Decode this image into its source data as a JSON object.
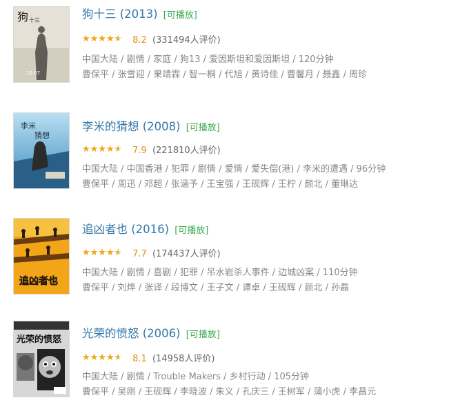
{
  "colors": {
    "title": "#3377aa",
    "play": "#3ba94d",
    "star": "#f4a70c",
    "score": "#e09015",
    "meta": "#888888"
  },
  "items": [
    {
      "title": "狗十三 (2013)",
      "play": "[可播放]",
      "rating_fraction": 0.8,
      "score": "8.2",
      "count": "(331494人评价)",
      "meta1": "中国大陆 / 剧情 / 家庭 / 狗13 / 爱因斯坦和爱因斯坦 / 120分钟",
      "meta2": "曹保平 / 张雪迎 / 果靖霖 / 智一桐 / 代旭 / 黄诗佳 / 曹馨月 / 聂鑫 / 周珍",
      "poster_text_a": "狗",
      "poster_text_b": "十三",
      "poster_date": "12·07"
    },
    {
      "title": "李米的猜想 (2008)",
      "play": "[可播放]",
      "rating_fraction": 0.8,
      "score": "7.9",
      "count": "(221810人评价)",
      "meta1": "中国大陆 / 中国香港 / 犯罪 / 剧情 / 爱情 / 爱失偿(港) / 李米的遭遇 / 96分钟",
      "meta2": "曹保平 / 周迅 / 邓超 / 张涵予 / 王宝强 / 王砚辉 / 王柠 / 颜北 / 董琳达",
      "poster_text_a": "李米",
      "poster_text_b": "猜想"
    },
    {
      "title": "追凶者也 (2016)",
      "play": "[可播放]",
      "rating_fraction": 0.8,
      "score": "7.7",
      "count": "(174437人评价)",
      "meta1": "中国大陆 / 剧情 / 喜剧 / 犯罪 / 吊水岩杀人事件 / 边城凶案 / 110分钟",
      "meta2": "曹保平 / 刘烨 / 张译 / 段博文 / 王子文 / 谭卓 / 王砚辉 / 颜北 / 孙磊",
      "poster_text_a": "追凶者也"
    },
    {
      "title": "光荣的愤怒 (2006)",
      "play": "[可播放]",
      "rating_fraction": 0.8,
      "score": "8.1",
      "count": "(14958人评价)",
      "meta1": "中国大陆 / 剧情 / Trouble Makers / 乡村行动 / 105分钟",
      "meta2": "曹保平 / 吴刚 / 王砚辉 / 李晓波 / 朱义 / 孔庆三 / 王树军 / 蒲小虎 / 李昌元",
      "poster_text_a": "光荣的愤怒"
    }
  ]
}
